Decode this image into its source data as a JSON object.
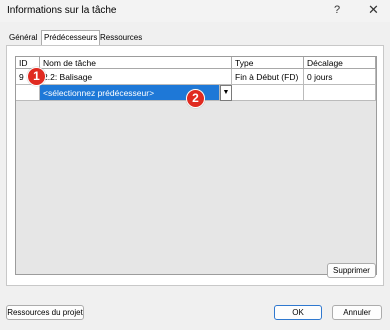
{
  "window": {
    "title": "Informations sur la tâche",
    "help_glyph": "?",
    "close_glyph": "✕"
  },
  "tabs": [
    {
      "label": "Général"
    },
    {
      "label": "Prédécesseurs"
    },
    {
      "label": "Ressources"
    }
  ],
  "grid": {
    "headers": {
      "id": "ID",
      "name": "Nom de tâche",
      "type": "Type",
      "lag": "Décalage"
    },
    "rows": [
      {
        "id": "9",
        "name": "2.2: Balisage",
        "type": "Fin à Début (FD)",
        "lag": "0 jours"
      }
    ],
    "new_row": {
      "name_placeholder": "<sélectionnez prédécesseur>",
      "dropdown_glyph": "▼"
    }
  },
  "badges": {
    "first": "1",
    "second": "2"
  },
  "buttons": {
    "delete": "Supprimer",
    "project_resources": "Ressources du projet",
    "ok": "OK",
    "cancel": "Annuler"
  }
}
